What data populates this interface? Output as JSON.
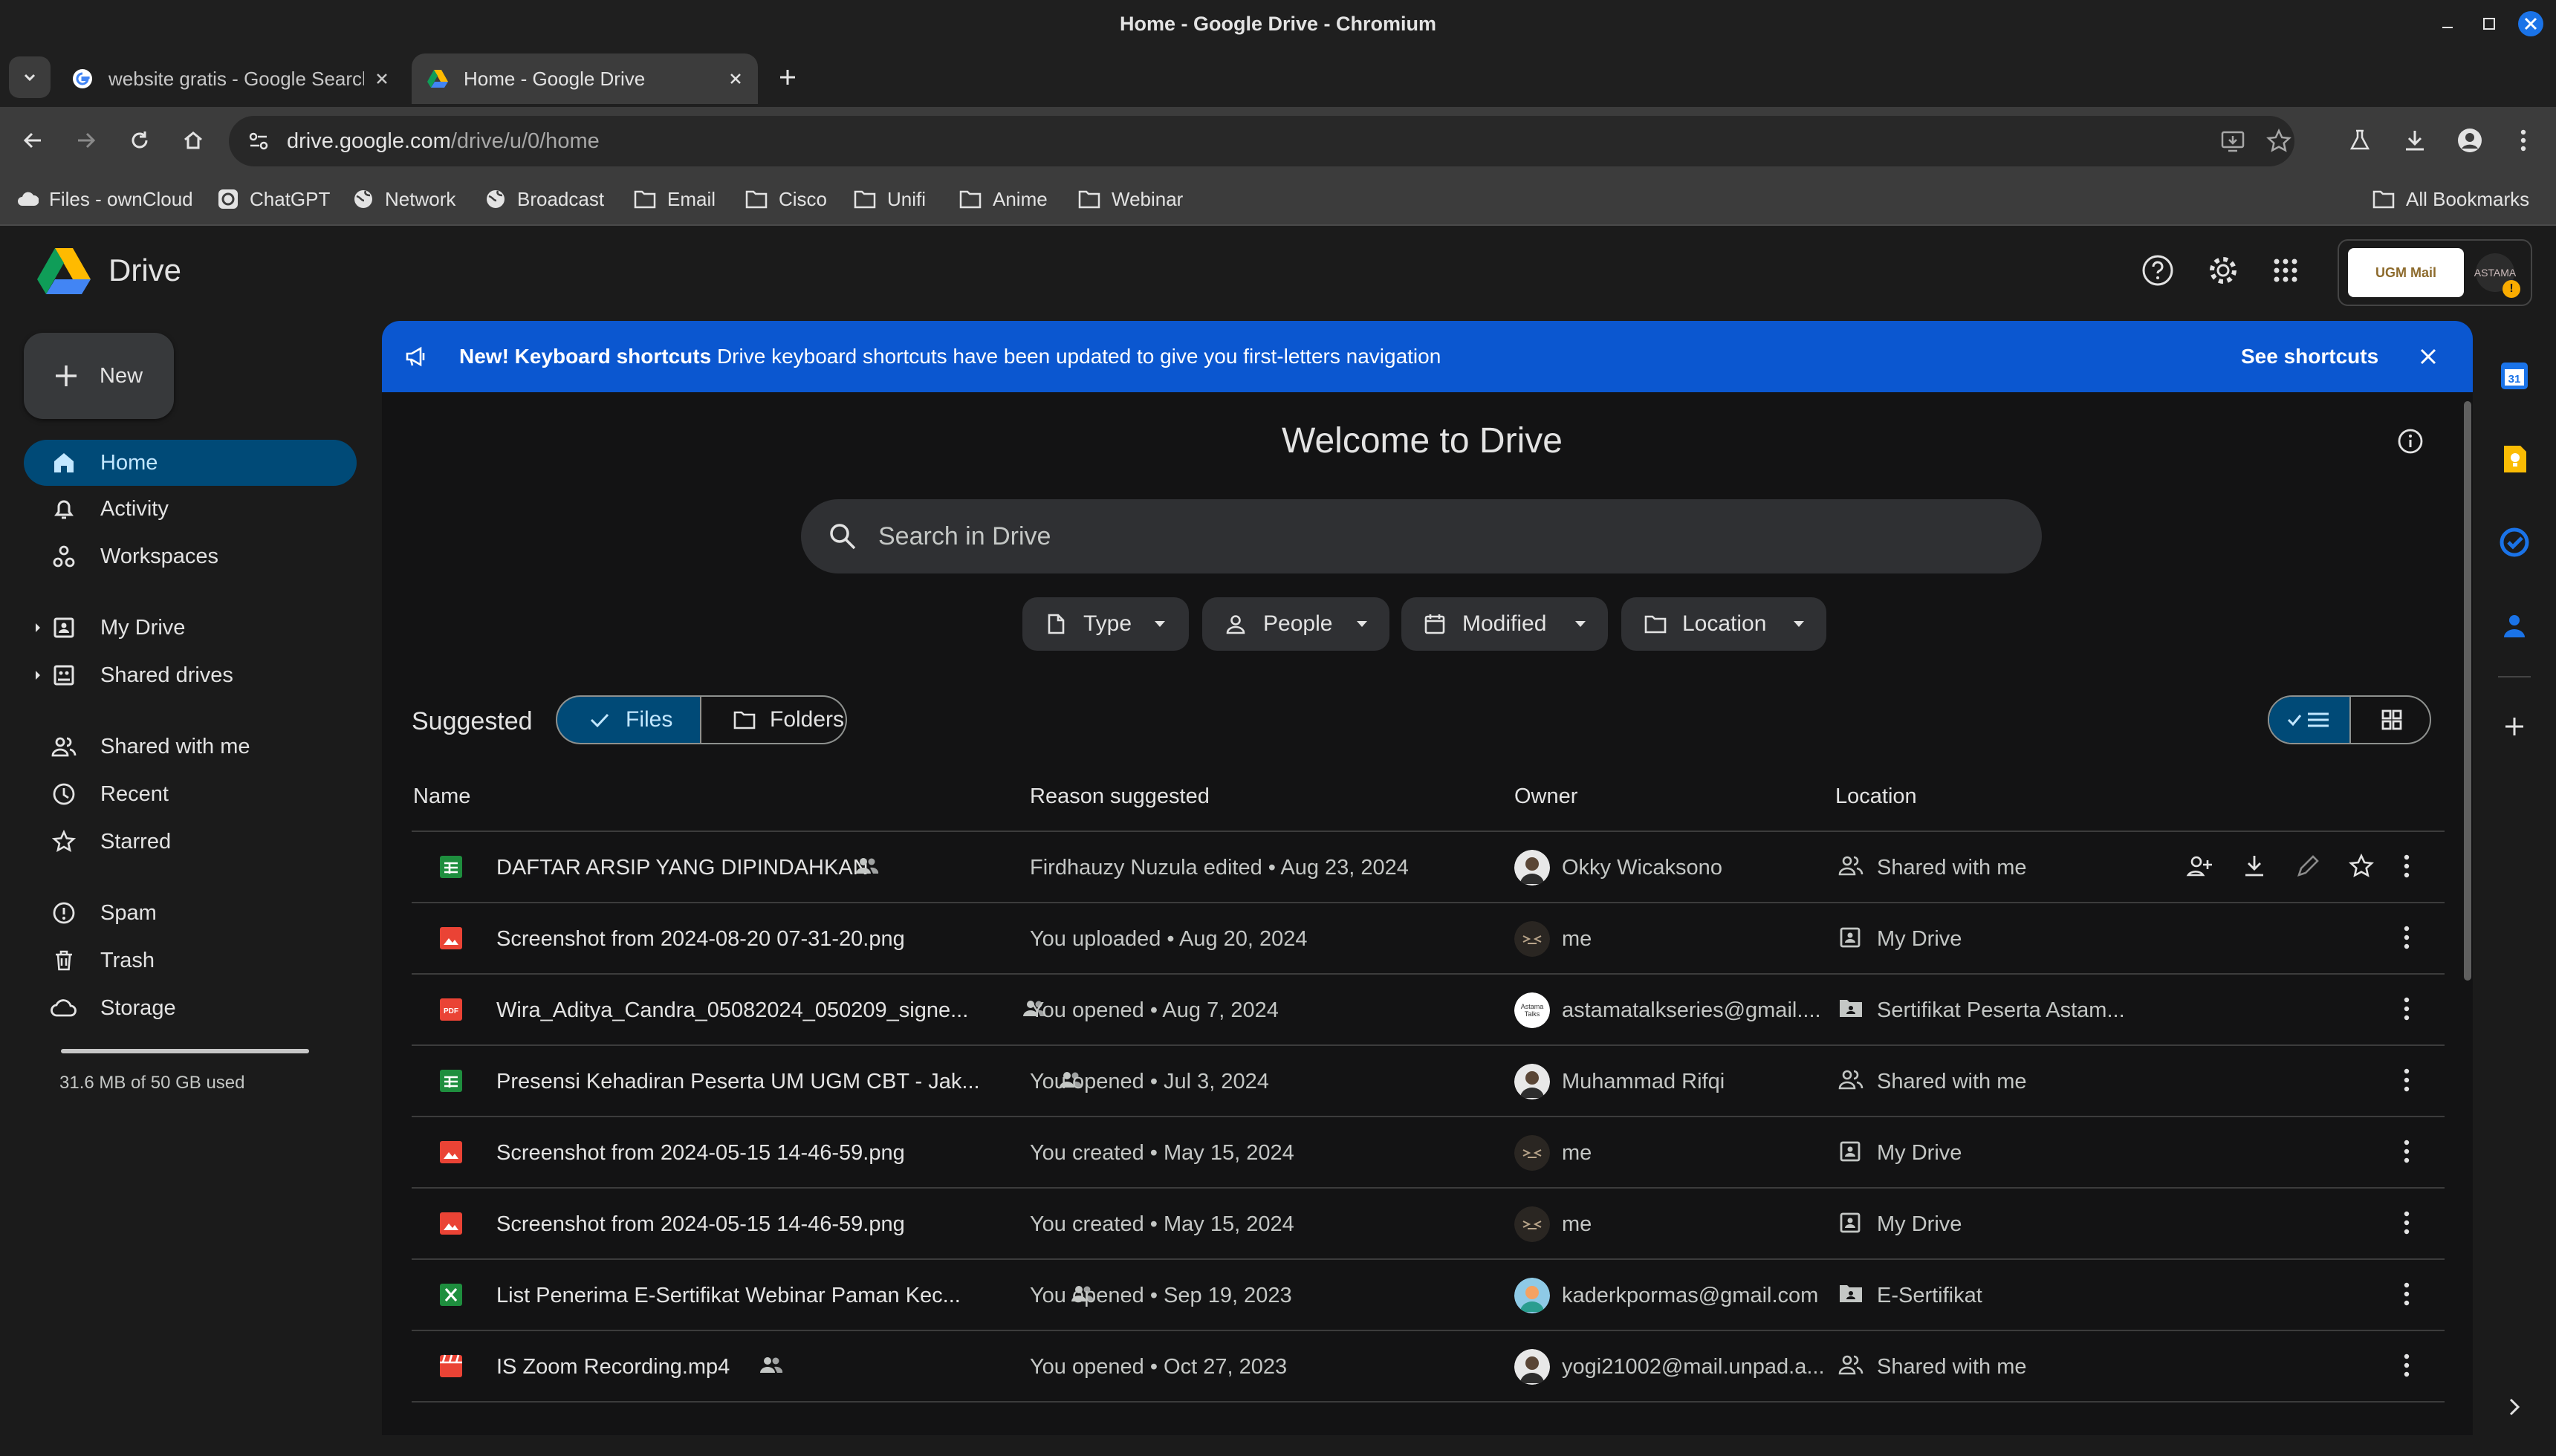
{
  "window": {
    "title": "Home - Google Drive - Chromium"
  },
  "tabs": [
    {
      "title": "website gratis - Google Search",
      "favicon": "google-g-icon"
    },
    {
      "title": "Home - Google Drive",
      "favicon": "drive-logo-icon"
    }
  ],
  "omnibox": {
    "host": "drive.google.com",
    "path": "/drive/u/0/home"
  },
  "bookmarks": [
    {
      "label": "Files - ownCloud",
      "icon": "owncloud-icon"
    },
    {
      "label": "ChatGPT",
      "icon": "chatgpt-icon"
    },
    {
      "label": "Network",
      "icon": "globe-icon"
    },
    {
      "label": "Broadcast",
      "icon": "globe-icon"
    },
    {
      "label": "Email",
      "icon": "folder-icon"
    },
    {
      "label": "Cisco",
      "icon": "folder-icon"
    },
    {
      "label": "Unifi",
      "icon": "folder-icon"
    },
    {
      "label": "Anime",
      "icon": "folder-icon"
    },
    {
      "label": "Webinar",
      "icon": "folder-icon"
    }
  ],
  "all_bookmarks": "All Bookmarks",
  "app": {
    "name": "Drive"
  },
  "account": {
    "org_label": "UGM Mail",
    "warning": "!",
    "avatar_text": "ASTAMA"
  },
  "sidebar": {
    "new_label": "New",
    "items": [
      {
        "label": "Home",
        "icon": "home-icon",
        "active": true
      },
      {
        "label": "Activity",
        "icon": "bell-icon"
      },
      {
        "label": "Workspaces",
        "icon": "workspaces-icon"
      },
      {
        "label": "My Drive",
        "icon": "my-drive-icon"
      },
      {
        "label": "Shared drives",
        "icon": "shared-drives-icon"
      },
      {
        "label": "Shared with me",
        "icon": "people-icon"
      },
      {
        "label": "Recent",
        "icon": "clock-icon"
      },
      {
        "label": "Starred",
        "icon": "star-icon"
      },
      {
        "label": "Spam",
        "icon": "spam-icon"
      },
      {
        "label": "Trash",
        "icon": "trash-icon"
      },
      {
        "label": "Storage",
        "icon": "cloud-icon"
      }
    ],
    "storage_text": "31.6 MB of 50 GB used",
    "storage_fraction": 0.0006
  },
  "banner": {
    "headline": "New! Keyboard shortcuts",
    "text": "Drive keyboard shortcuts have been updated to give you first-letters navigation",
    "action": "See shortcuts"
  },
  "welcome": "Welcome to Drive",
  "search": {
    "placeholder": "Search in Drive"
  },
  "filters": [
    "Type",
    "People",
    "Modified",
    "Location"
  ],
  "suggested": {
    "label": "Suggested",
    "files": "Files",
    "folders": "Folders"
  },
  "columns": {
    "name": "Name",
    "reason": "Reason suggested",
    "owner": "Owner",
    "location": "Location"
  },
  "rows": [
    {
      "name": "DAFTAR ARSIP YANG DIPINDAHKAN",
      "type": "sheets",
      "shared": true,
      "reason": "Firdhauzy Nuzula edited • Aug 23, 2024",
      "owner": "Okky Wicaksono",
      "owner_avatar": "photo",
      "location": "Shared with me",
      "loc_icon": "people-icon"
    },
    {
      "name": "Screenshot from 2024-08-20 07-31-20.png",
      "type": "image",
      "shared": false,
      "reason": "You uploaded • Aug 20, 2024",
      "owner": "me",
      "owner_avatar": "logo",
      "location": "My Drive",
      "loc_icon": "my-drive-icon"
    },
    {
      "name": "Wira_Aditya_Candra_05082024_050209_signe...",
      "type": "pdf",
      "shared": true,
      "reason": "You opened • Aug 7, 2024",
      "owner": "astamatalkseries@gmail....",
      "owner_avatar": "astama",
      "location": "Sertifikat Peserta Astam...",
      "loc_icon": "shared-folder-icon"
    },
    {
      "name": "Presensi Kehadiran Peserta UM UGM CBT - Jak...",
      "type": "sheets",
      "shared": true,
      "reason": "You opened • Jul 3, 2024",
      "owner": "Muhammad Rifqi",
      "owner_avatar": "photo",
      "location": "Shared with me",
      "loc_icon": "people-icon"
    },
    {
      "name": "Screenshot from 2024-05-15 14-46-59.png",
      "type": "image",
      "shared": false,
      "reason": "You created • May 15, 2024",
      "owner": "me",
      "owner_avatar": "logo",
      "location": "My Drive",
      "loc_icon": "my-drive-icon"
    },
    {
      "name": "Screenshot from 2024-05-15 14-46-59.png",
      "type": "image",
      "shared": false,
      "reason": "You created • May 15, 2024",
      "owner": "me",
      "owner_avatar": "logo",
      "location": "My Drive",
      "loc_icon": "my-drive-icon"
    },
    {
      "name": "List Penerima E-Sertifikat Webinar Paman Kec...",
      "type": "excel",
      "shared": true,
      "reason": "You opened • Sep 19, 2023",
      "owner": "kaderkpormas@gmail.com",
      "owner_avatar": "color",
      "location": "E-Sertifikat",
      "loc_icon": "shared-folder-icon"
    },
    {
      "name": "IS Zoom Recording.mp4",
      "type": "video",
      "shared": true,
      "reason": "You opened • Oct 27, 2023",
      "owner": "yogi21002@mail.unpad.a...",
      "owner_avatar": "photo",
      "location": "Shared with me",
      "loc_icon": "people-icon"
    }
  ],
  "colors": {
    "banner": "#0b57d0",
    "active_nav": "#004a77",
    "sheets": "#1e8e3e",
    "image": "#ea4335",
    "pdf": "#ea4335",
    "excel": "#1e8e3e",
    "video": "#ea4335"
  }
}
